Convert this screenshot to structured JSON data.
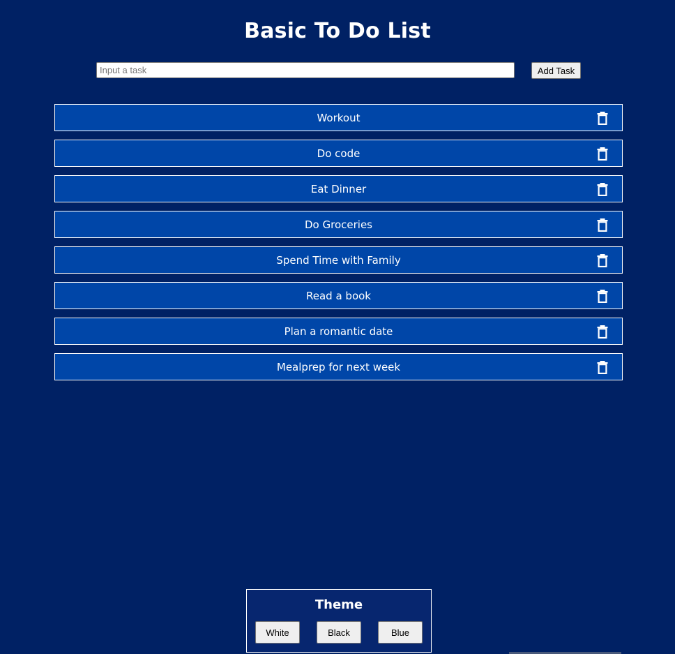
{
  "header": {
    "title": "Basic To Do List"
  },
  "form": {
    "placeholder": "Input a task",
    "value": "",
    "add_label": "Add Task"
  },
  "tasks": [
    {
      "label": "Workout",
      "icon": "trash-icon"
    },
    {
      "label": "Do code",
      "icon": "trash-icon"
    },
    {
      "label": "Eat Dinner",
      "icon": "trash-icon"
    },
    {
      "label": "Do Groceries",
      "icon": "trash-icon"
    },
    {
      "label": "Spend Time with Family",
      "icon": "trash-icon"
    },
    {
      "label": "Read a book",
      "icon": "trash-icon"
    },
    {
      "label": "Plan a romantic date",
      "icon": "trash-icon"
    },
    {
      "label": "Mealprep for next week",
      "icon": "trash-icon"
    }
  ],
  "theme": {
    "title": "Theme",
    "options": [
      "White",
      "Black",
      "Blue"
    ],
    "selected": "Blue"
  },
  "colors": {
    "background": "#002164",
    "task_background": "#0046a8",
    "theme_panel": "#07266f",
    "text": "#ffffff"
  }
}
